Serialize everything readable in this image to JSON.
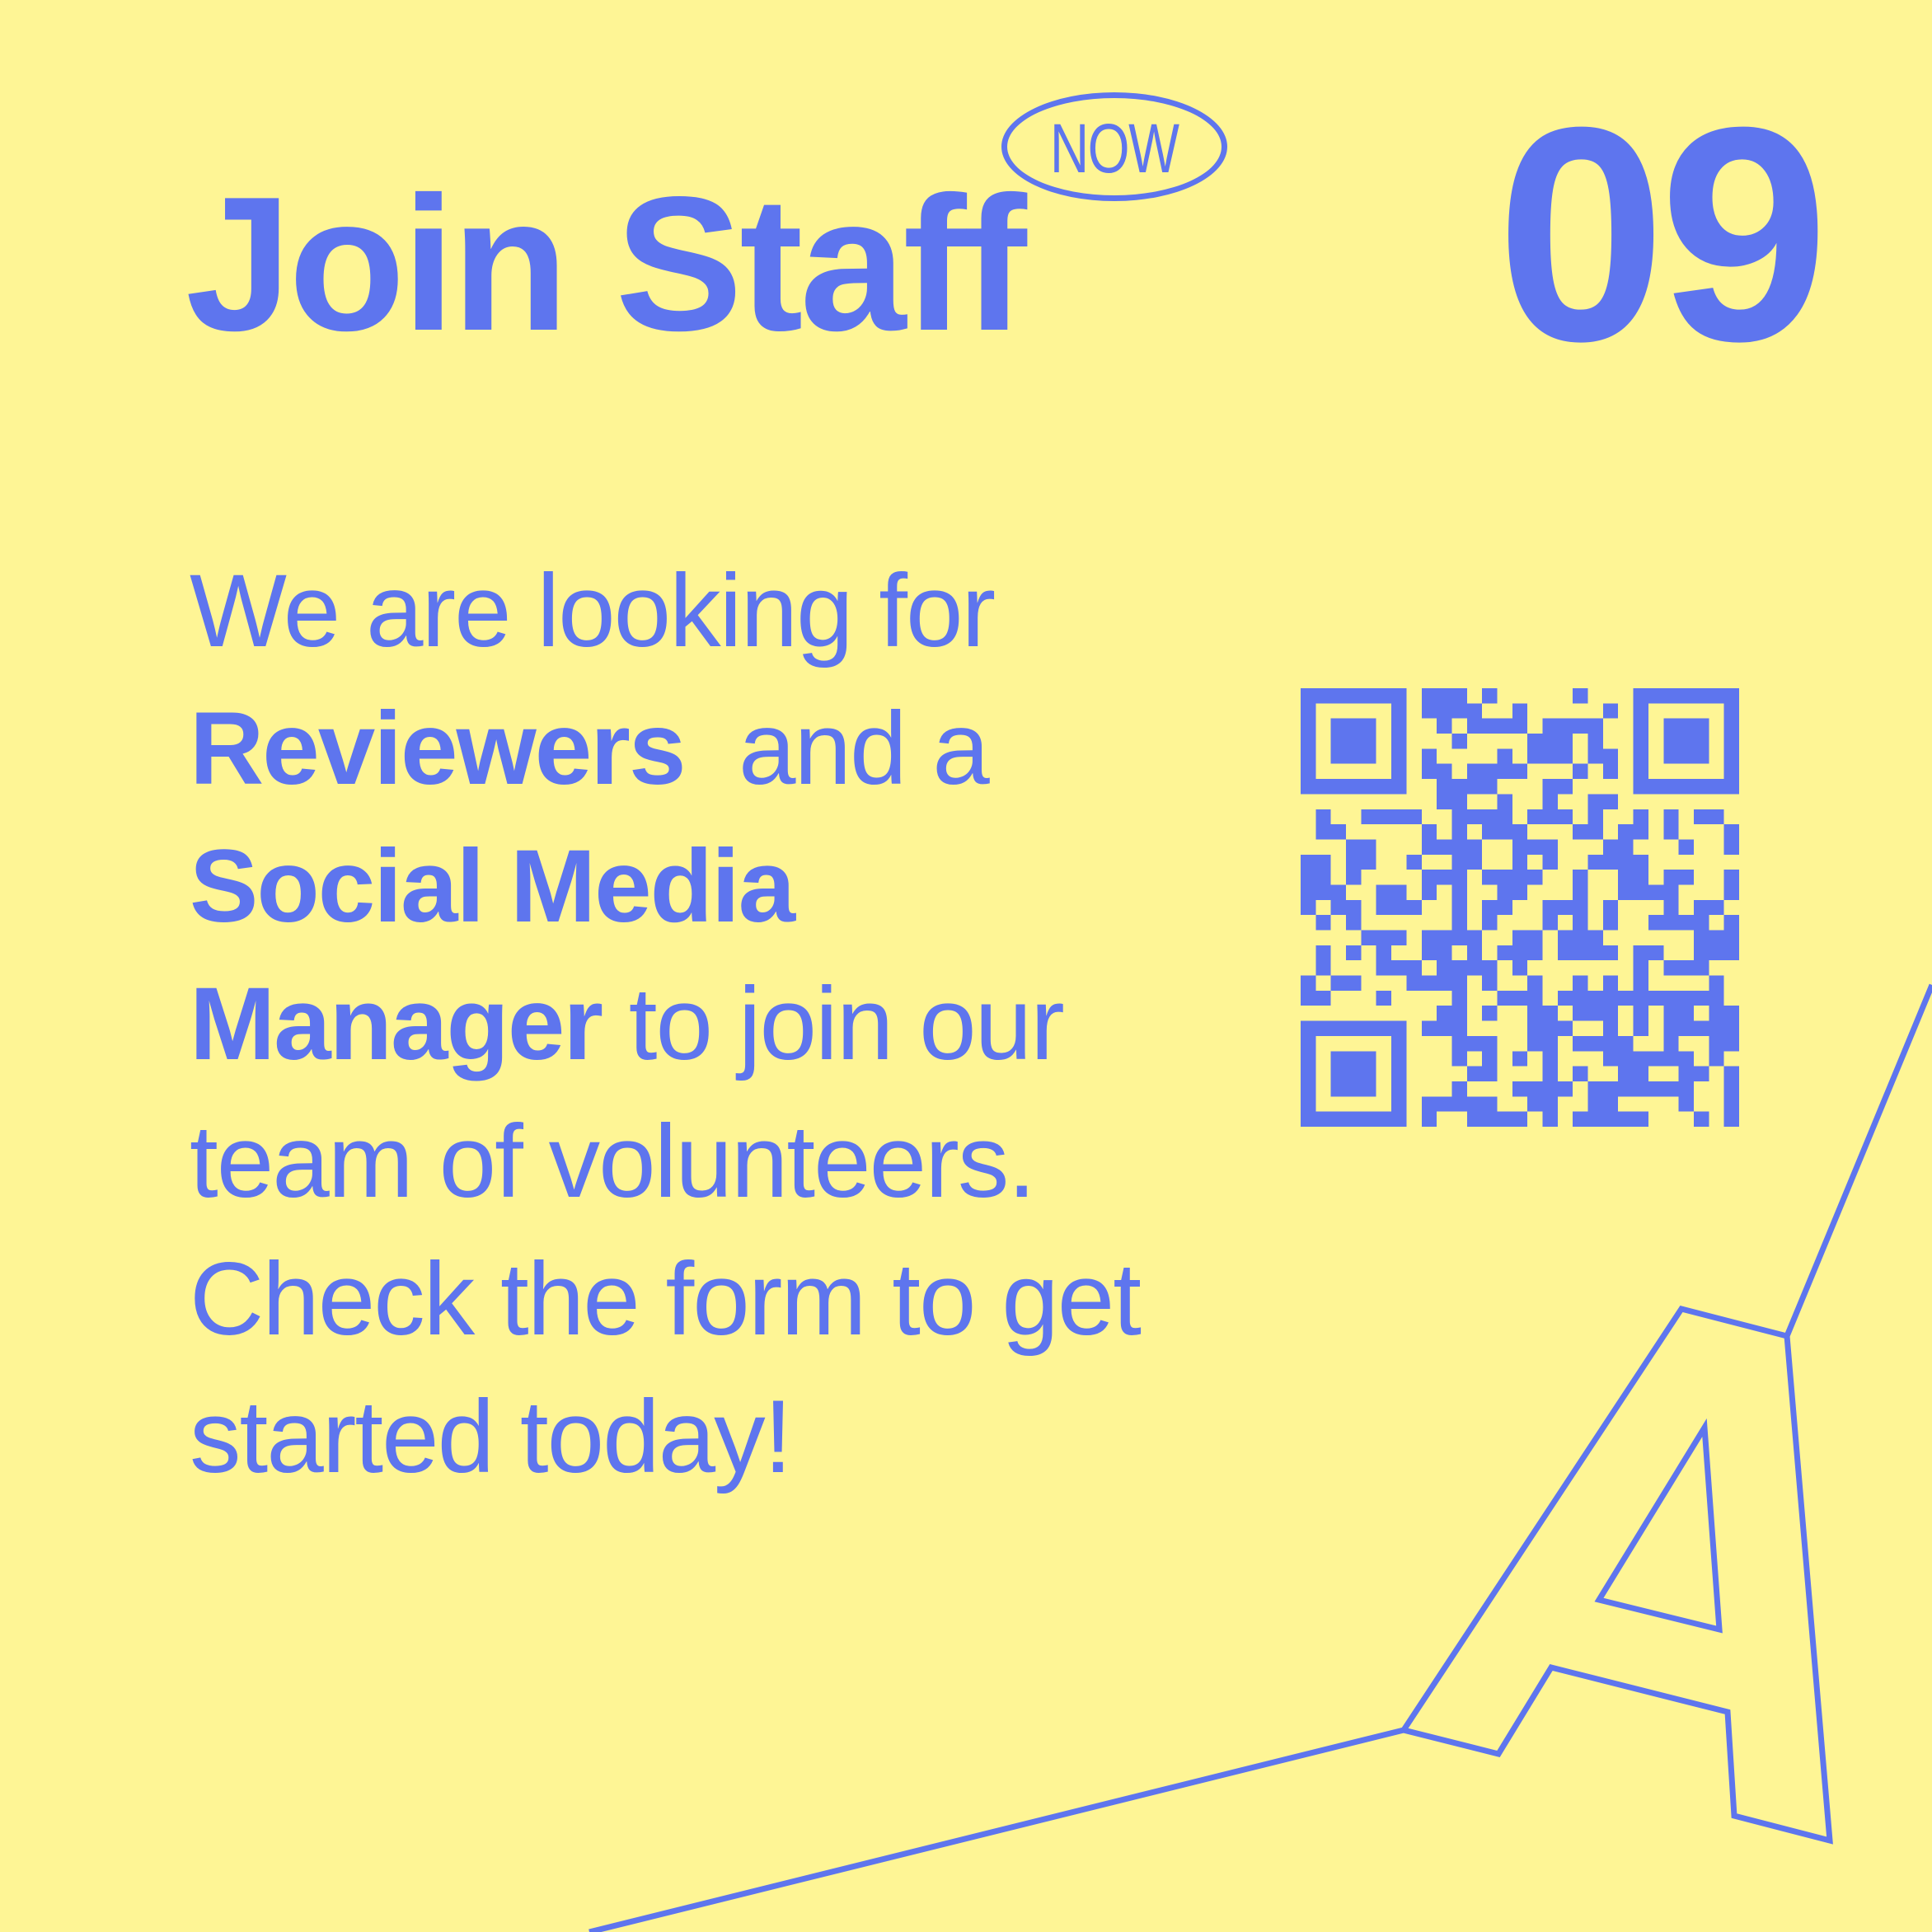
{
  "poster": {
    "title": "Join Staff",
    "badge": "NOW",
    "number": "09",
    "body": {
      "line1": "We are looking for",
      "role1": "Reviewers",
      "line2_rest": "and a",
      "role2_line1": "Social Media",
      "role2_line2": "Manager",
      "line4_rest": "to join our",
      "line5": "team of volunteers.",
      "line6": "Check the form to get",
      "line7": "started today!"
    },
    "colors": {
      "background": "#FEF595",
      "accent": "#5E75EE"
    },
    "icons": {
      "qr": "qr-code-icon",
      "letter": "letter-a-outline-icon"
    }
  }
}
